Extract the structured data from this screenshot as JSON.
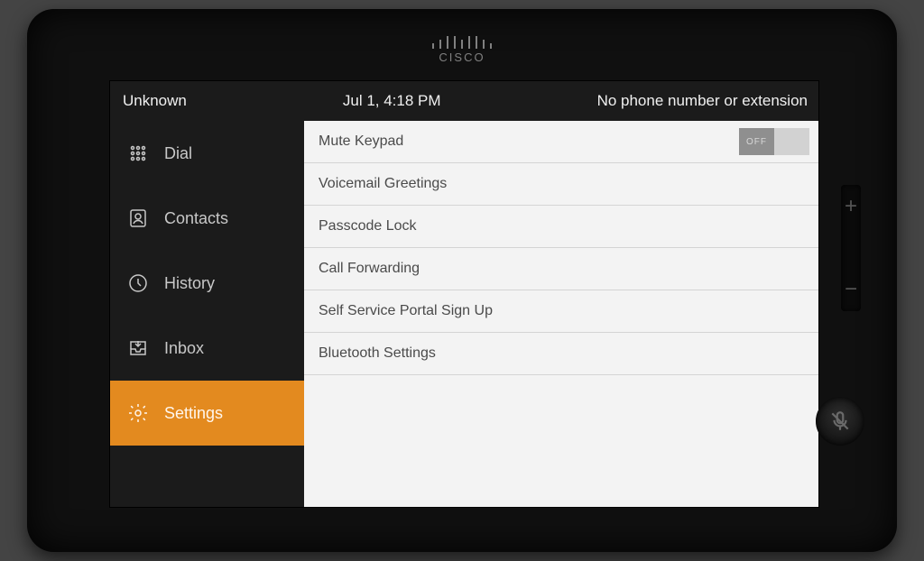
{
  "brand": "CISCO",
  "status": {
    "left": "Unknown",
    "datetime": "Jul 1, 4:18 PM",
    "right": "No phone number or extension"
  },
  "sidebar": {
    "items": [
      {
        "id": "dial",
        "label": "Dial",
        "icon": "keypad-icon",
        "active": false
      },
      {
        "id": "contacts",
        "label": "Contacts",
        "icon": "contacts-icon",
        "active": false
      },
      {
        "id": "history",
        "label": "History",
        "icon": "history-icon",
        "active": false
      },
      {
        "id": "inbox",
        "label": "Inbox",
        "icon": "inbox-icon",
        "active": false
      },
      {
        "id": "settings",
        "label": "Settings",
        "icon": "gear-icon",
        "active": true
      }
    ]
  },
  "settings_list": [
    {
      "id": "mute_keypad",
      "label": "Mute Keypad",
      "type": "toggle",
      "value": "OFF"
    },
    {
      "id": "voicemail_greetings",
      "label": "Voicemail Greetings",
      "type": "link"
    },
    {
      "id": "passcode_lock",
      "label": "Passcode Lock",
      "type": "link"
    },
    {
      "id": "call_forwarding",
      "label": "Call Forwarding",
      "type": "link"
    },
    {
      "id": "self_service",
      "label": "Self Service Portal Sign Up",
      "type": "link"
    },
    {
      "id": "bluetooth",
      "label": "Bluetooth Settings",
      "type": "link"
    }
  ],
  "colors": {
    "accent": "#e38a1f",
    "sidebar_bg": "#1b1b1b",
    "content_bg": "#f3f3f3"
  }
}
